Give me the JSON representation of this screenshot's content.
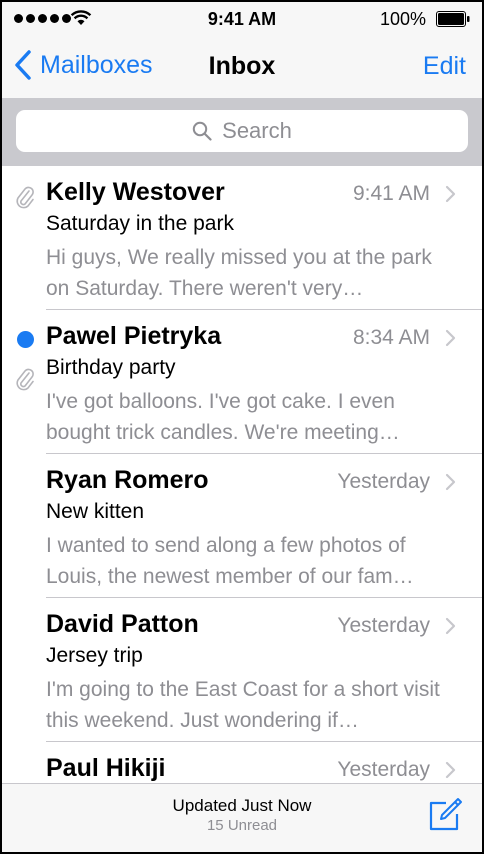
{
  "status_bar": {
    "time": "9:41 AM",
    "battery": "100%"
  },
  "nav": {
    "back_label": "Mailboxes",
    "title": "Inbox",
    "edit_label": "Edit"
  },
  "search": {
    "placeholder": "Search"
  },
  "messages": [
    {
      "sender": "Kelly Westover",
      "time": "9:41 AM",
      "subject": "Saturday in the park",
      "preview": "Hi guys, We really missed you at the park on Saturday. There weren't very…",
      "unread": false,
      "attachment": true
    },
    {
      "sender": "Pawel Pietryka",
      "time": "8:34 AM",
      "subject": "Birthday party",
      "preview": "I've got balloons. I've got cake. I even bought trick candles. We're meeting…",
      "unread": true,
      "attachment": true
    },
    {
      "sender": "Ryan Romero",
      "time": "Yesterday",
      "subject": "New kitten",
      "preview": "I wanted to send along a few photos of Louis, the newest member of our fam…",
      "unread": false,
      "attachment": false
    },
    {
      "sender": "David Patton",
      "time": "Yesterday",
      "subject": "Jersey trip",
      "preview": "I'm going to the East Coast for a short visit this weekend. Just wondering if…",
      "unread": false,
      "attachment": false
    },
    {
      "sender": "Paul Hikiji",
      "time": "Yesterday",
      "subject": "",
      "preview": "",
      "unread": false,
      "attachment": false
    }
  ],
  "toolbar": {
    "updated": "Updated Just Now",
    "unread_count": "15 Unread"
  },
  "colors": {
    "accent": "#1a7bf2",
    "secondary_text": "#8e8e93",
    "separator": "#c8c7cc"
  },
  "icons": [
    "wifi-icon",
    "battery-icon",
    "back-chevron-icon",
    "search-icon",
    "paperclip-icon",
    "unread-dot-icon",
    "chevron-right-icon",
    "compose-icon"
  ]
}
